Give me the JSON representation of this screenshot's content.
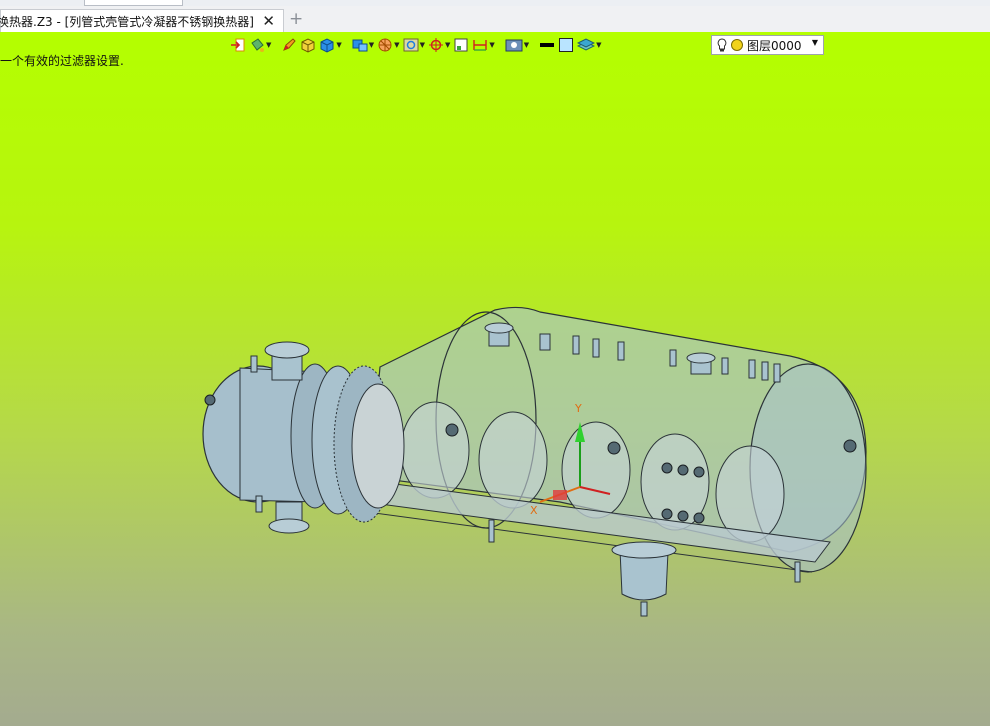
{
  "tab": {
    "title": "换热器.Z3 - [列管式壳管式冷凝器不锈钢换热器]",
    "close": "✕",
    "add": "+"
  },
  "viewport": {
    "status_message": "一个有效的过滤器设置."
  },
  "toolbar": {
    "buttons": [
      {
        "icon": "exit-sketch-icon",
        "dropdown": false
      },
      {
        "icon": "paint-bucket-icon",
        "dropdown": true
      },
      {
        "icon": "pencil-icon",
        "dropdown": false
      },
      {
        "icon": "shaded-cube-icon",
        "dropdown": false
      },
      {
        "icon": "display-mode-cube-icon",
        "dropdown": true
      },
      {
        "icon": "view-cube-icon",
        "dropdown": true
      },
      {
        "icon": "section-view-icon",
        "dropdown": true
      },
      {
        "icon": "zoom-window-icon",
        "dropdown": true
      },
      {
        "icon": "target-snap-icon",
        "dropdown": true
      },
      {
        "icon": "grid-icon",
        "dropdown": false
      },
      {
        "icon": "dimension-icon",
        "dropdown": true
      },
      {
        "icon": "render-settings-icon",
        "dropdown": true
      },
      {
        "icon": "line-color-icon",
        "dropdown": false
      },
      {
        "icon": "fill-color-icon",
        "dropdown": false
      },
      {
        "icon": "layer-stack-icon",
        "dropdown": true
      }
    ],
    "layer_name": "图层0000",
    "colors": {
      "accent": "#1f7de0",
      "selector_bulb": "#f2d31b"
    }
  },
  "axes": {
    "y": "Y",
    "x": "X"
  },
  "colors": {
    "background_top": "#b4ff00",
    "background_bottom": "#a4ab8f",
    "shell": "#a9c3cf",
    "edge": "#2b3338"
  }
}
